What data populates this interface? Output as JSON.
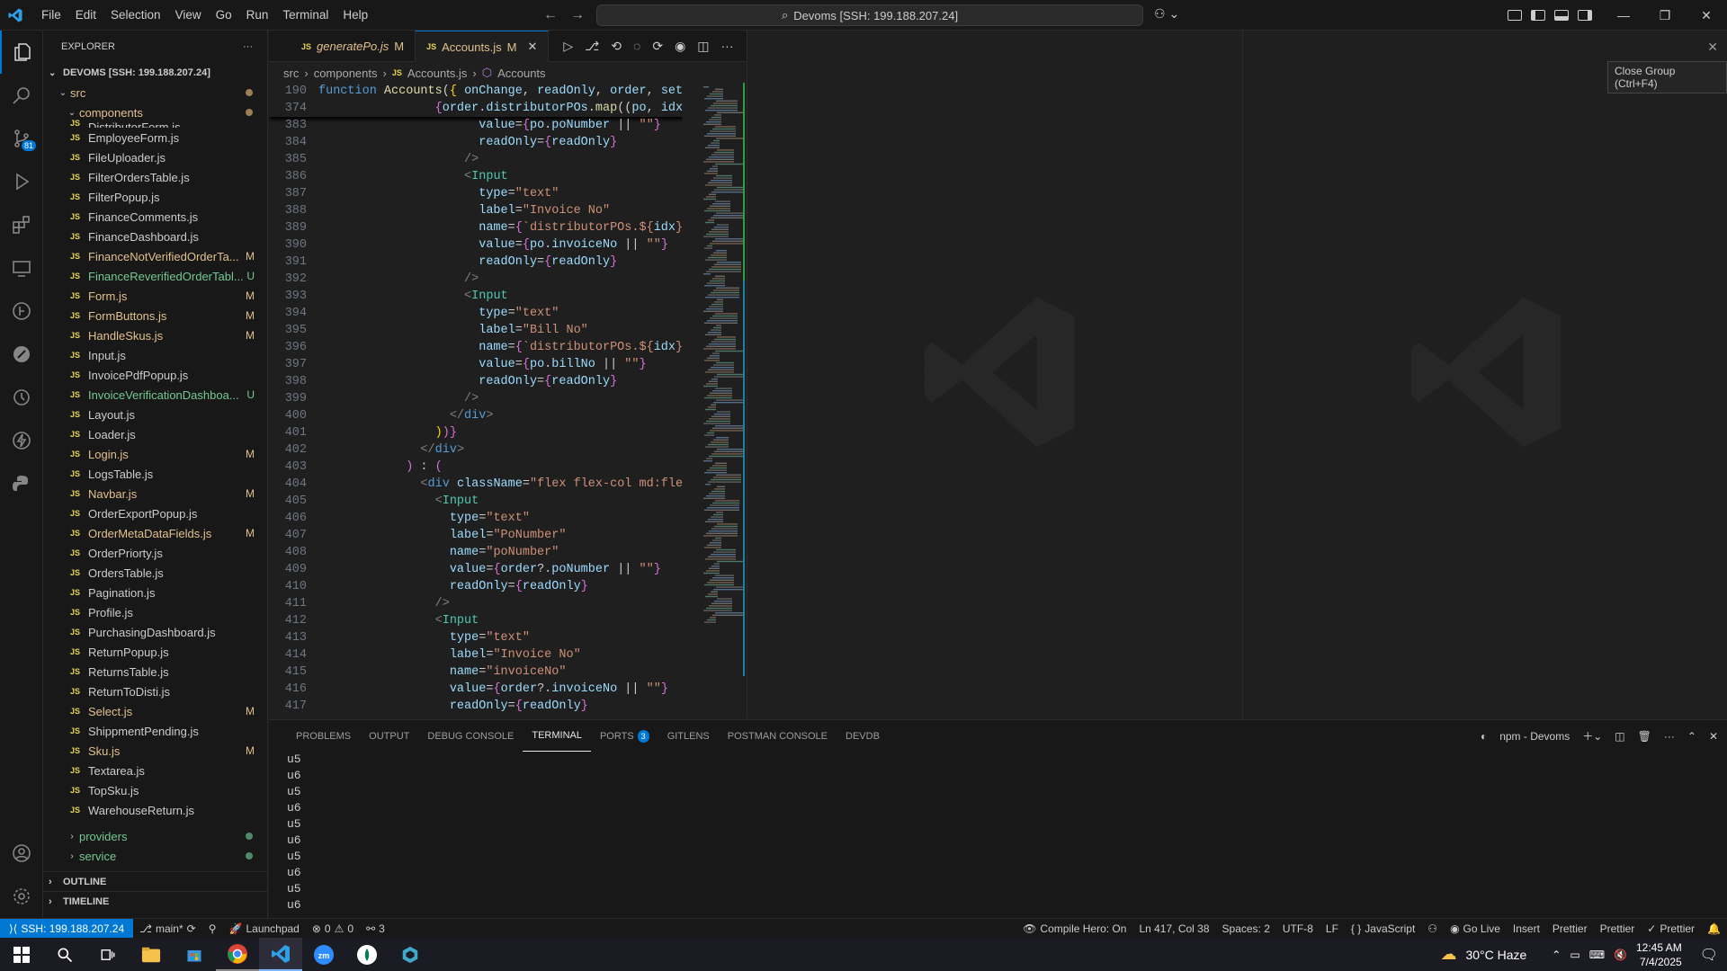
{
  "menu": [
    "File",
    "Edit",
    "Selection",
    "View",
    "Go",
    "Run",
    "Terminal",
    "Help"
  ],
  "command_center": "Devoms [SSH: 199.188.207.24]",
  "explorer": {
    "title": "EXPLORER",
    "root": "DEVOMS [SSH: 199.188.207.24]",
    "src": "src",
    "components": "components",
    "cut_file": "DistributorForm.js",
    "files": [
      {
        "name": "EmployeeForm.js",
        "status": ""
      },
      {
        "name": "FileUploader.js",
        "status": ""
      },
      {
        "name": "FilterOrdersTable.js",
        "status": ""
      },
      {
        "name": "FilterPopup.js",
        "status": ""
      },
      {
        "name": "FinanceComments.js",
        "status": ""
      },
      {
        "name": "FinanceDashboard.js",
        "status": ""
      },
      {
        "name": "FinanceNotVerifiedOrderTa...",
        "status": "M"
      },
      {
        "name": "FinanceReverifiedOrderTabl...",
        "status": "U"
      },
      {
        "name": "Form.js",
        "status": "M"
      },
      {
        "name": "FormButtons.js",
        "status": "M"
      },
      {
        "name": "HandleSkus.js",
        "status": "M"
      },
      {
        "name": "Input.js",
        "status": ""
      },
      {
        "name": "InvoicePdfPopup.js",
        "status": ""
      },
      {
        "name": "InvoiceVerificationDashboa...",
        "status": "U"
      },
      {
        "name": "Layout.js",
        "status": ""
      },
      {
        "name": "Loader.js",
        "status": ""
      },
      {
        "name": "Login.js",
        "status": "M"
      },
      {
        "name": "LogsTable.js",
        "status": ""
      },
      {
        "name": "Navbar.js",
        "status": "M"
      },
      {
        "name": "OrderExportPopup.js",
        "status": ""
      },
      {
        "name": "OrderMetaDataFields.js",
        "status": "M"
      },
      {
        "name": "OrderPriorty.js",
        "status": ""
      },
      {
        "name": "OrdersTable.js",
        "status": ""
      },
      {
        "name": "Pagination.js",
        "status": ""
      },
      {
        "name": "Profile.js",
        "status": ""
      },
      {
        "name": "PurchasingDashboard.js",
        "status": ""
      },
      {
        "name": "ReturnPopup.js",
        "status": ""
      },
      {
        "name": "ReturnsTable.js",
        "status": ""
      },
      {
        "name": "ReturnToDisti.js",
        "status": ""
      },
      {
        "name": "Select.js",
        "status": "M"
      },
      {
        "name": "ShippmentPending.js",
        "status": ""
      },
      {
        "name": "Sku.js",
        "status": "M"
      },
      {
        "name": "Textarea.js",
        "status": ""
      },
      {
        "name": "TopSku.js",
        "status": ""
      },
      {
        "name": "WarehouseReturn.js",
        "status": ""
      }
    ],
    "providers": "providers",
    "service": "service",
    "outline": "OUTLINE",
    "timeline": "TIMELINE"
  },
  "tabs": [
    {
      "name": "generatePo.js",
      "status": "M"
    },
    {
      "name": "Accounts.js",
      "status": "M"
    }
  ],
  "breadcrumb": [
    "src",
    "components",
    "Accounts.js",
    "Accounts"
  ],
  "sticky": [
    {
      "ln": "190",
      "html": "<span class='kw'>function</span> <span class='fn'>Accounts</span>(<span class='yl'>{</span> <span class='at'>onChange</span>, <span class='at'>readOnly</span>, <span class='at'>order</span>, <span class='at'>setO</span>"
    },
    {
      "ln": "374",
      "html": "                <span class='br'>{</span><span class='at'>order</span>.<span class='at'>distributorPOs</span>.<span class='fn'>map</span>((<span class='at'>po</span>, <span class='at'>idx</span>)"
    }
  ],
  "code": [
    {
      "ln": "383",
      "html": "                      <span class='at'>value</span>=<span class='br'>{</span><span class='at'>po</span>.<span class='at'>poNumber</span> || <span class='str'>\"\"</span><span class='br'>}</span>"
    },
    {
      "ln": "384",
      "html": "                      <span class='at'>readOnly</span>=<span class='br'>{</span><span class='at'>readOnly</span><span class='br'>}</span>"
    },
    {
      "ln": "385",
      "html": "                    <span class='gray'>/&gt;</span>"
    },
    {
      "ln": "386",
      "html": "                    <span class='gray'>&lt;</span><span class='tg'>Input</span>"
    },
    {
      "ln": "387",
      "html": "                      <span class='at'>type</span>=<span class='str'>\"text\"</span>"
    },
    {
      "ln": "388",
      "html": "                      <span class='at'>label</span>=<span class='str'>\"Invoice No\"</span>"
    },
    {
      "ln": "389",
      "html": "                      <span class='at'>name</span>=<span class='br'>{</span><span class='str'>`distributorPOs.${</span><span class='at'>idx</span><span class='str'>}.</span>"
    },
    {
      "ln": "390",
      "html": "                      <span class='at'>value</span>=<span class='br'>{</span><span class='at'>po</span>.<span class='at'>invoiceNo</span> || <span class='str'>\"\"</span><span class='br'>}</span>"
    },
    {
      "ln": "391",
      "html": "                      <span class='at'>readOnly</span>=<span class='br'>{</span><span class='at'>readOnly</span><span class='br'>}</span>"
    },
    {
      "ln": "392",
      "html": "                    <span class='gray'>/&gt;</span>"
    },
    {
      "ln": "393",
      "html": "                    <span class='gray'>&lt;</span><span class='tg'>Input</span>"
    },
    {
      "ln": "394",
      "html": "                      <span class='at'>type</span>=<span class='str'>\"text\"</span>"
    },
    {
      "ln": "395",
      "html": "                      <span class='at'>label</span>=<span class='str'>\"Bill No\"</span>"
    },
    {
      "ln": "396",
      "html": "                      <span class='at'>name</span>=<span class='br'>{</span><span class='str'>`distributorPOs.${</span><span class='at'>idx</span><span class='str'>}.</span>"
    },
    {
      "ln": "397",
      "html": "                      <span class='at'>value</span>=<span class='br'>{</span><span class='at'>po</span>.<span class='at'>billNo</span> || <span class='str'>\"\"</span><span class='br'>}</span>"
    },
    {
      "ln": "398",
      "html": "                      <span class='at'>readOnly</span>=<span class='br'>{</span><span class='at'>readOnly</span><span class='br'>}</span>"
    },
    {
      "ln": "399",
      "html": "                    <span class='gray'>/&gt;</span>"
    },
    {
      "ln": "400",
      "html": "                  <span class='gray'>&lt;/</span><span class='kw'>div</span><span class='gray'>&gt;</span>"
    },
    {
      "ln": "401",
      "html": "                <span class='yl'>)</span><span class='br'>)}</span>"
    },
    {
      "ln": "402",
      "html": "              <span class='gray'>&lt;/</span><span class='kw'>div</span><span class='gray'>&gt;</span>"
    },
    {
      "ln": "403",
      "html": "            <span class='br'>)</span> : <span class='br'>(</span>"
    },
    {
      "ln": "404",
      "html": "              <span class='gray'>&lt;</span><span class='kw'>div</span> <span class='at'>className</span>=<span class='str'>\"flex flex-col md:flex</span>"
    },
    {
      "ln": "405",
      "html": "                <span class='gray'>&lt;</span><span class='tg'>Input</span>"
    },
    {
      "ln": "406",
      "html": "                  <span class='at'>type</span>=<span class='str'>\"text\"</span>"
    },
    {
      "ln": "407",
      "html": "                  <span class='at'>label</span>=<span class='str'>\"PoNumber\"</span>"
    },
    {
      "ln": "408",
      "html": "                  <span class='at'>name</span>=<span class='str'>\"poNumber\"</span>"
    },
    {
      "ln": "409",
      "html": "                  <span class='at'>value</span>=<span class='br'>{</span><span class='at'>order</span>?.<span class='at'>poNumber</span> || <span class='str'>\"\"</span><span class='br'>}</span>"
    },
    {
      "ln": "410",
      "html": "                  <span class='at'>readOnly</span>=<span class='br'>{</span><span class='at'>readOnly</span><span class='br'>}</span>"
    },
    {
      "ln": "411",
      "html": "                <span class='gray'>/&gt;</span>"
    },
    {
      "ln": "412",
      "html": "                <span class='gray'>&lt;</span><span class='tg'>Input</span>"
    },
    {
      "ln": "413",
      "html": "                  <span class='at'>type</span>=<span class='str'>\"text\"</span>"
    },
    {
      "ln": "414",
      "html": "                  <span class='at'>label</span>=<span class='str'>\"Invoice No\"</span>"
    },
    {
      "ln": "415",
      "html": "                  <span class='at'>name</span>=<span class='str'>\"invoiceNo\"</span>"
    },
    {
      "ln": "416",
      "html": "                  <span class='at'>value</span>=<span class='br'>{</span><span class='at'>order</span>?.<span class='at'>invoiceNo</span> || <span class='str'>\"\"</span><span class='br'>}</span>"
    },
    {
      "ln": "417",
      "html": "                  <span class='at'>readOnly</span>=<span class='br'>{</span><span class='at'>readOnly</span><span class='br'>}</span>"
    }
  ],
  "tooltip": "Close Group (Ctrl+F4)",
  "panel": {
    "tabs": [
      "PROBLEMS",
      "OUTPUT",
      "DEBUG CONSOLE",
      "TERMINAL",
      "PORTS",
      "GITLENS",
      "POSTMAN CONSOLE",
      "DEVDB"
    ],
    "ports_badge": "3",
    "terminal_name": "npm - Devoms",
    "lines": [
      "u5",
      "u6",
      "u5",
      "u6",
      "u5",
      "u6",
      "u5",
      "u6",
      "u5",
      "u6"
    ]
  },
  "status": {
    "remote": "SSH: 199.188.207.24",
    "branch": "main*",
    "launchpad": "Launchpad",
    "errors": "0",
    "warnings": "0",
    "ports": "3",
    "compile_hero": "Compile Hero: On",
    "position": "Ln 417, Col 38",
    "spaces": "Spaces: 2",
    "encoding": "UTF-8",
    "eol": "LF",
    "language": "JavaScript",
    "go_live": "Go Live",
    "insert": "Insert",
    "prettier1": "Prettier",
    "prettier2": "Prettier",
    "prettier3": "Prettier"
  },
  "taskbar": {
    "weather": "30°C  Haze",
    "time": "12:45 AM",
    "date": "7/4/2025"
  },
  "colors": {
    "accent": "#0078d4",
    "modified": "#e2c08d",
    "untracked": "#73c991"
  }
}
